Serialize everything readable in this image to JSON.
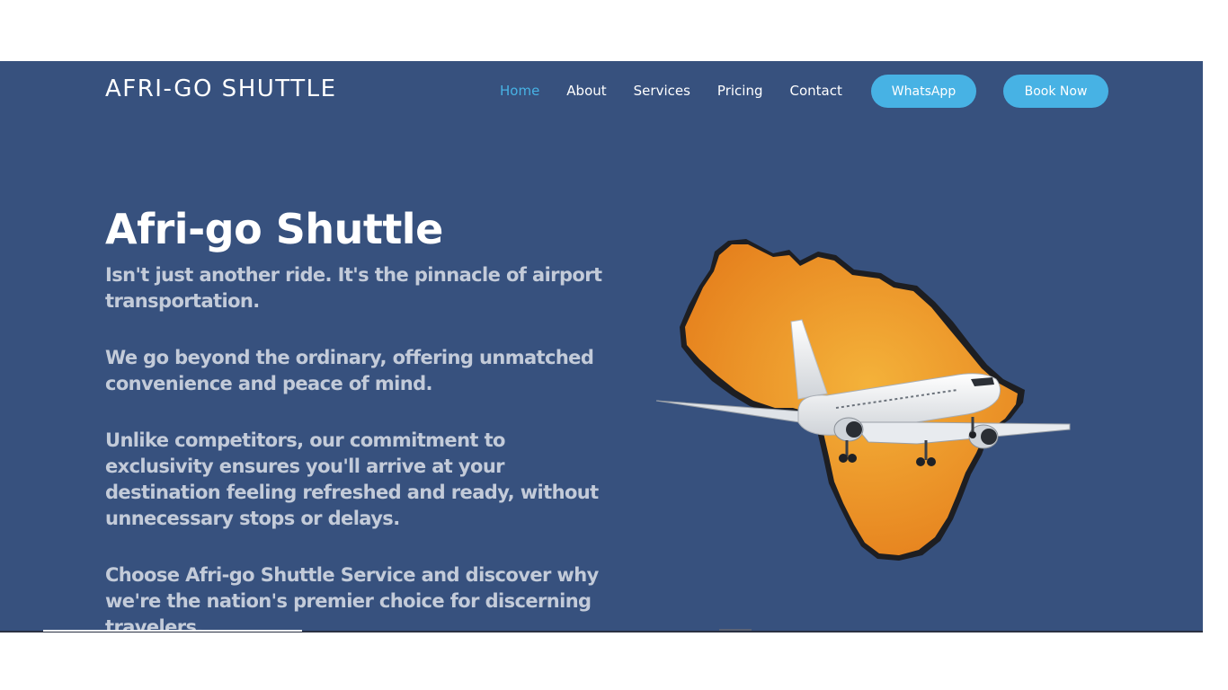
{
  "header": {
    "brand": "AFRI-GO SHUTTLE",
    "nav": [
      {
        "label": "Home",
        "active": true
      },
      {
        "label": "About",
        "active": false
      },
      {
        "label": "Services",
        "active": false
      },
      {
        "label": "Pricing",
        "active": false
      },
      {
        "label": "Contact",
        "active": false
      }
    ],
    "whatsapp_label": "WhatsApp",
    "book_label": "Book Now"
  },
  "hero": {
    "title": "Afri-go Shuttle",
    "paragraphs": [
      "Isn't just another ride. It's the pinnacle of airport transportation.",
      "We go beyond the ordinary, offering unmatched convenience and peace of mind.",
      "Unlike competitors, our commitment to exclusivity ensures you'll arrive at your destination feeling refreshed and ready, without unnecessary stops or delays.",
      "Choose Afri-go Shuttle Service and discover why we're the nation's premier choice for discerning travelers."
    ]
  },
  "illustration": {
    "icon": "africa-map-with-airplane",
    "colors": {
      "map": "#f0a020",
      "plane": "#ffffff"
    }
  },
  "colors": {
    "background": "#37517e",
    "accent": "#47b2e4",
    "text": "#c3cbd9"
  }
}
